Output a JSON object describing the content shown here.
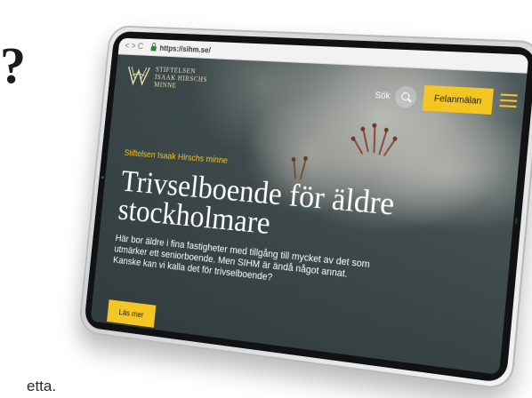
{
  "background": {
    "question_mark": "?",
    "trailing_text": "etta."
  },
  "browser": {
    "nav_buttons": "< > C",
    "url": "https://sihm.se/"
  },
  "site": {
    "logo_lines": [
      "STIFTELSEN",
      "ISAAK HIRSCHS",
      "MINNE"
    ],
    "search_label": "Sök",
    "report_button": "Felanmälan",
    "menu_icon": "hamburger-menu-icon"
  },
  "hero": {
    "kicker": "Stiftelsen Isaak Hirschs minne",
    "headline_line1": "Trivselboende för äldre",
    "headline_line2": "stockholmare",
    "intro": "Här bor äldre i fina fastigheter med tillgång till mycket av det som utmärker ett seniorboende. Men SIHM är ändå något annat. Kanske kan vi kalla det för trivselboende?",
    "cta": "Läs mer"
  },
  "colors": {
    "accent": "#f3c623",
    "logo_gold": "#f0e2b0",
    "hero_dark": "#3a4547"
  }
}
